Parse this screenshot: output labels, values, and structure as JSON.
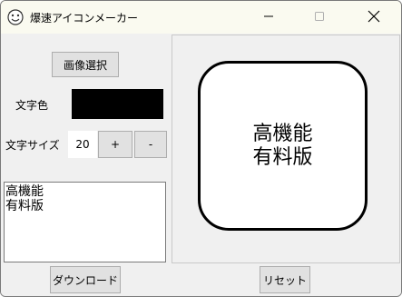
{
  "window": {
    "title": "爆速アイコンメーカー",
    "icon": "app-face-icon"
  },
  "titlebar": {
    "minimize_icon": "minimize-icon",
    "maximize_icon": "maximize-icon",
    "close_icon": "close-icon"
  },
  "controls": {
    "select_image_label": "画像選択",
    "text_color_label": "文字色",
    "text_color_value": "#000000",
    "font_size_label": "文字サイズ",
    "font_size_value": "20",
    "increase_label": "+",
    "decrease_label": "-"
  },
  "text_input": {
    "value": "高機能\n有料版"
  },
  "preview": {
    "text": "高機能\n有料版",
    "background": "#ffffff",
    "border_color": "#000000"
  },
  "footer": {
    "download_label": "ダウンロード",
    "reset_label": "リセット"
  }
}
